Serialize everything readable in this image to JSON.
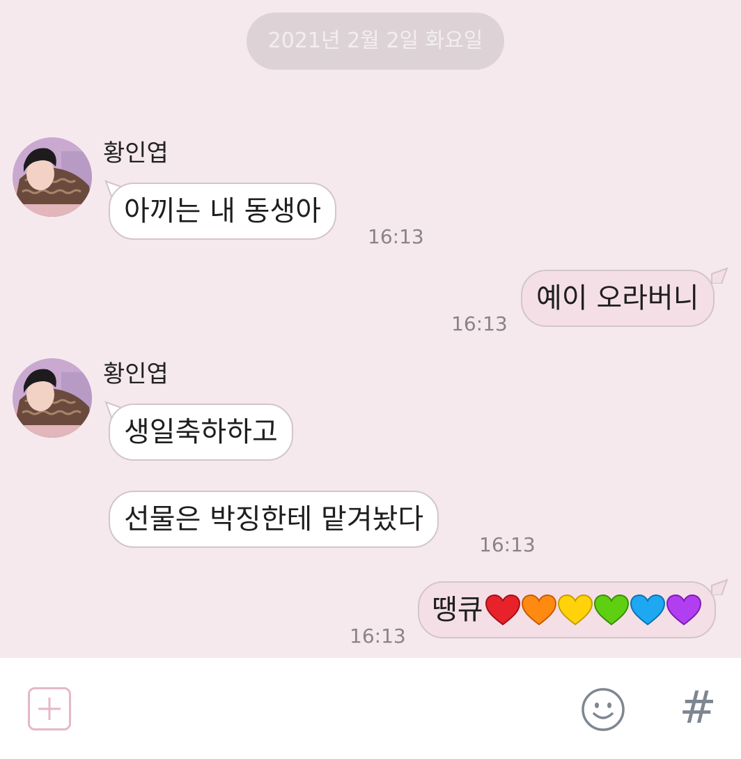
{
  "date_divider": "2021년 2월 2일 화요일",
  "messages": [
    {
      "sender": "황인엽",
      "text": "아끼는 내 동생아",
      "time": "16:13"
    },
    {
      "text": "예이 오라버니",
      "time": "16:13"
    },
    {
      "sender": "황인엽",
      "text": "생일축하하고"
    },
    {
      "text": "선물은 박징한테 맡겨놨다",
      "time": "16:13"
    },
    {
      "text": "땡큐",
      "time": "16:13"
    }
  ],
  "hearts": [
    "red-heart",
    "orange-heart",
    "yellow-heart",
    "green-heart",
    "blue-heart",
    "purple-heart"
  ],
  "colors": {
    "chat_background": "#f5e9ee",
    "outgoing_bubble": "#f4dfe7",
    "incoming_bubble": "#ffffff",
    "accent": "#e5b7c8"
  },
  "input_bar": {
    "icons": [
      "plus-icon",
      "emoji-icon",
      "hashtag-icon"
    ],
    "hash_glyph": "#"
  }
}
